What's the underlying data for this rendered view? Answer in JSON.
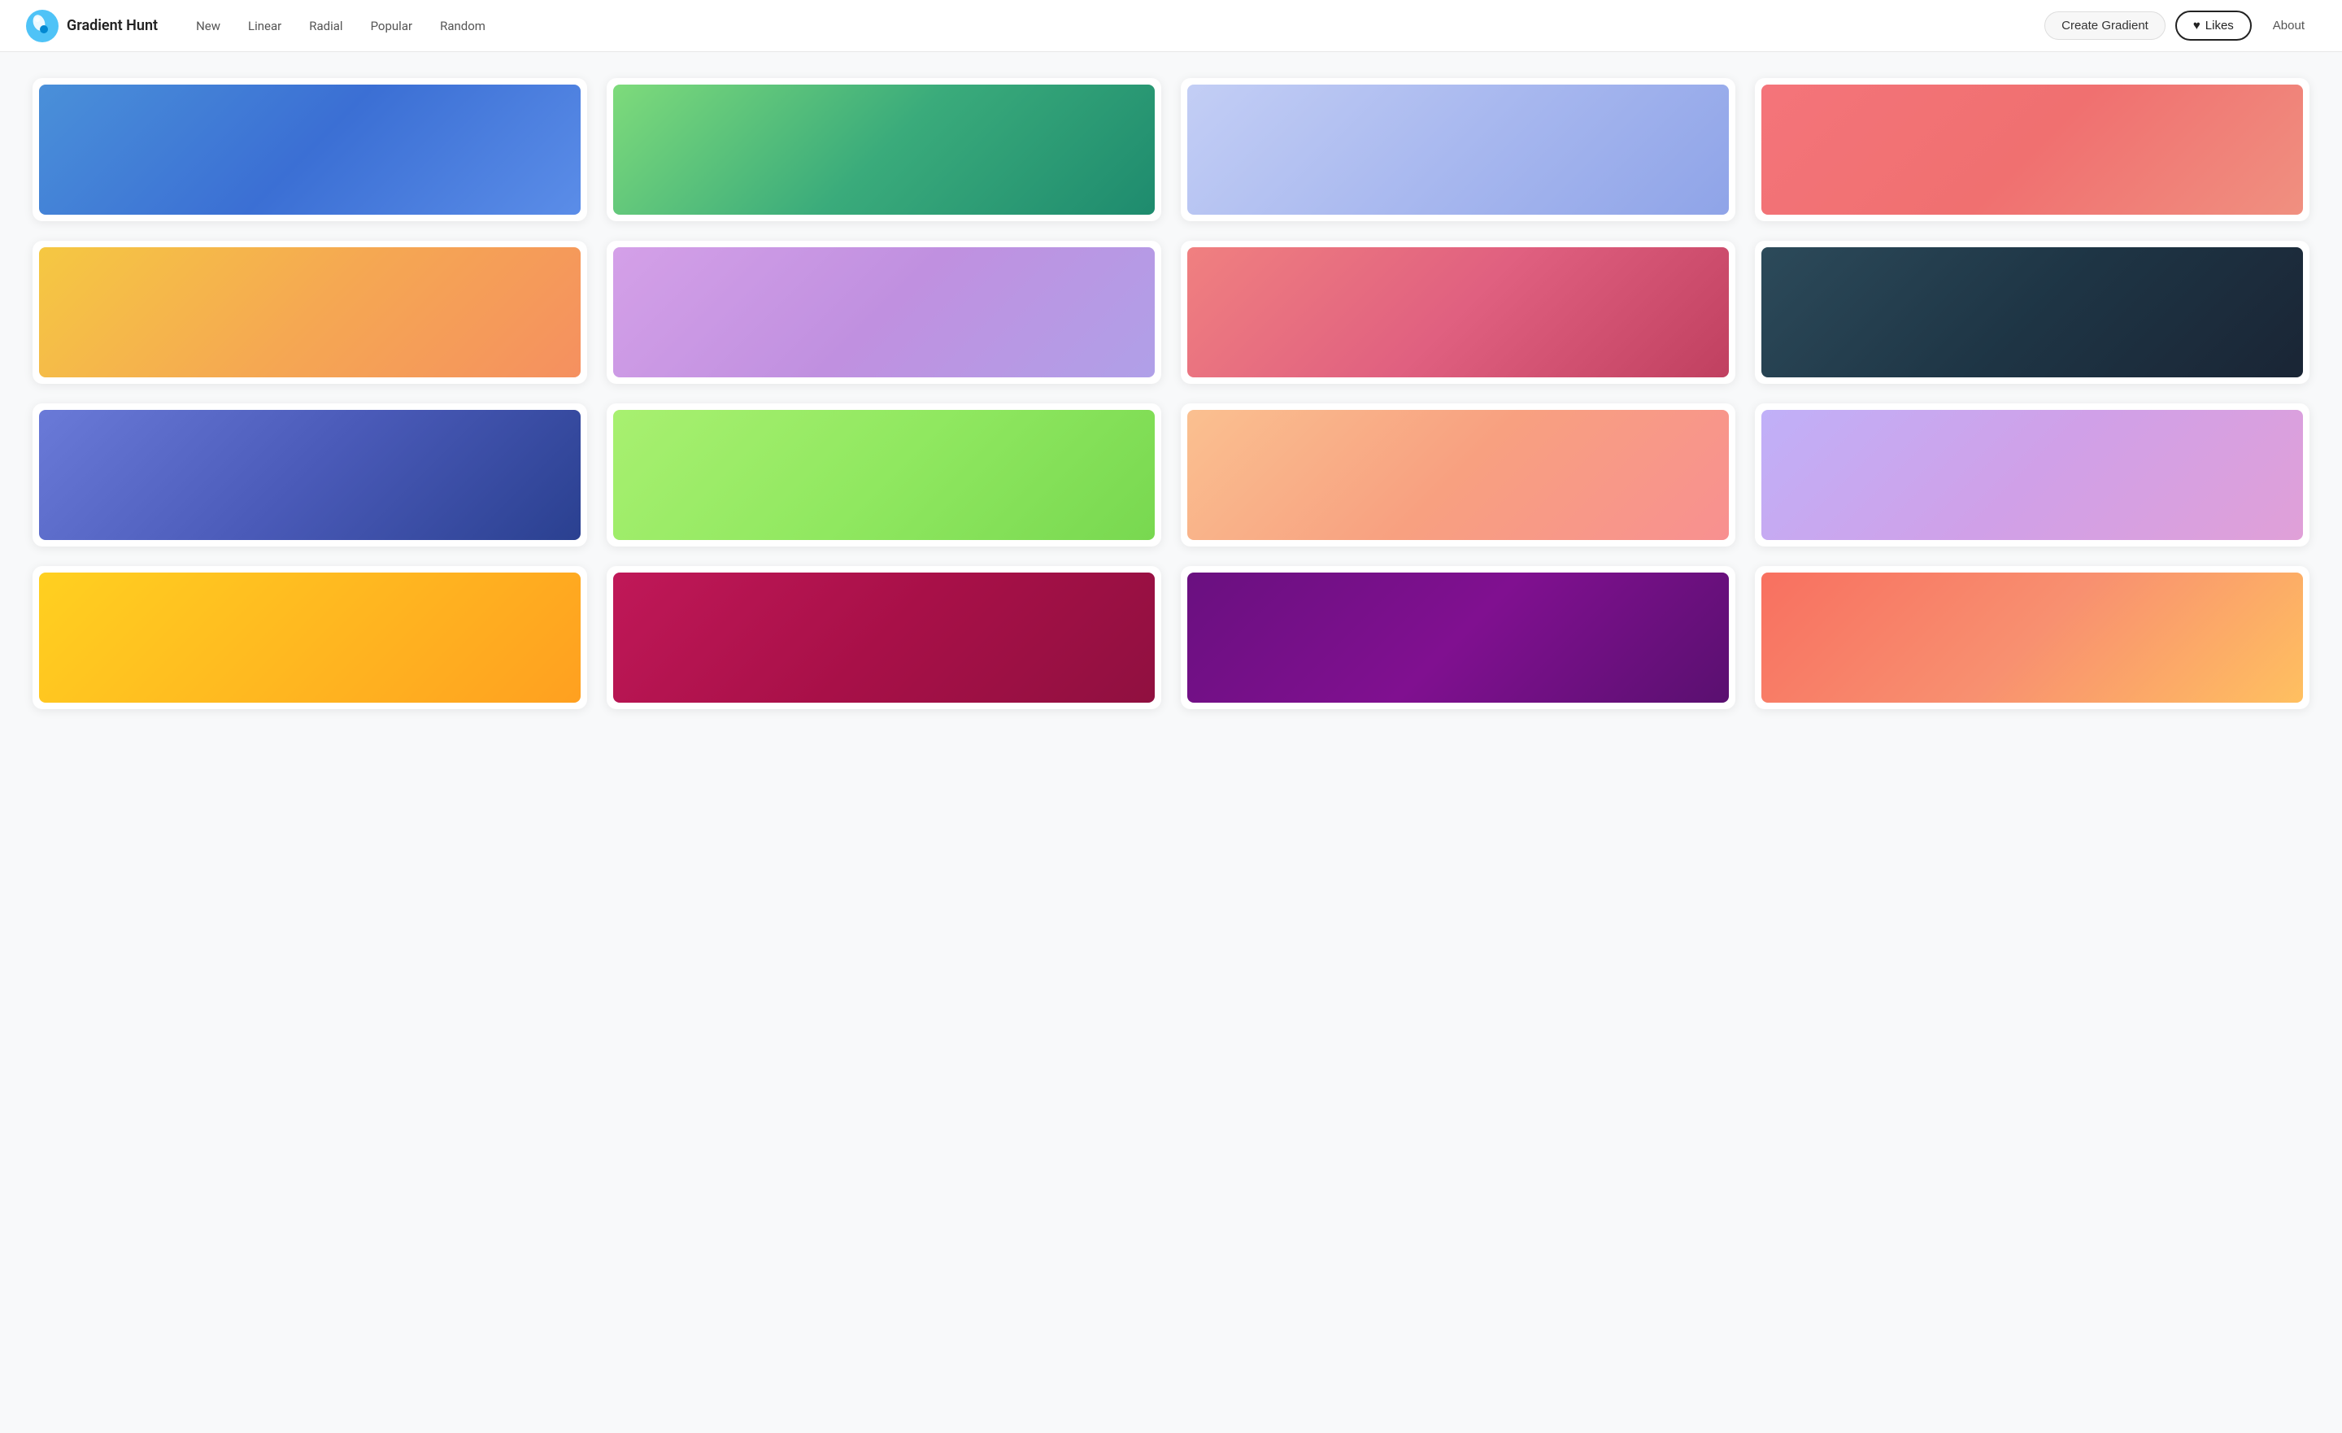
{
  "header": {
    "logo_text": "Gradient Hunt",
    "nav_items": [
      {
        "label": "New",
        "id": "new"
      },
      {
        "label": "Linear",
        "id": "linear"
      },
      {
        "label": "Radial",
        "id": "radial"
      },
      {
        "label": "Popular",
        "id": "popular"
      },
      {
        "label": "Random",
        "id": "random"
      }
    ],
    "create_button": "Create Gradient",
    "likes_button": "Likes",
    "about_button": "About",
    "heart_icon": "♥"
  },
  "gradients": [
    {
      "id": 1,
      "css": "linear-gradient(135deg, #4a90d9 0%, #3b6fd4 50%, #5b8de8 100%)"
    },
    {
      "id": 2,
      "css": "linear-gradient(135deg, #7edb7b 0%, #3aab7b 50%, #1e8b6e 100%)"
    },
    {
      "id": 3,
      "css": "linear-gradient(135deg, #c3cef5 0%, #a8b8ef 50%, #8fa4e8 100%)"
    },
    {
      "id": 4,
      "css": "linear-gradient(135deg, #f4747a 0%, #f07070 50%, #f09080 100%)"
    },
    {
      "id": 5,
      "css": "linear-gradient(135deg, #f5c842 0%, #f5a852 50%, #f59060 100%)"
    },
    {
      "id": 6,
      "css": "linear-gradient(135deg, #d4a0e8 0%, #c090e0 50%, #b0a0e8 100%)"
    },
    {
      "id": 7,
      "css": "linear-gradient(135deg, #f08080 0%, #e06080 50%, #c04060 100%)"
    },
    {
      "id": 8,
      "css": "linear-gradient(135deg, #2c4a5a 0%, #1e3545 50%, #1a2535 100%)"
    },
    {
      "id": 9,
      "css": "linear-gradient(135deg, #6a7ad8 0%, #4a5ab8 50%, #2a4090 100%)"
    },
    {
      "id": 10,
      "css": "linear-gradient(135deg, #a8f070 0%, #90e860 50%, #78d850 100%)"
    },
    {
      "id": 11,
      "css": "linear-gradient(135deg, #fac090 0%, #f8a080 50%, #f89090 100%)"
    },
    {
      "id": 12,
      "css": "linear-gradient(135deg, #c0b0f8 0%, #d0a0e8 50%, #e0a0d8 100%)"
    },
    {
      "id": 13,
      "css": "linear-gradient(135deg, #ffd020 0%, #ffb820 50%, #ffa020 100%)"
    },
    {
      "id": 14,
      "css": "linear-gradient(135deg, #c01858 0%, #a81048 50%, #901040 100%)"
    },
    {
      "id": 15,
      "css": "linear-gradient(135deg, #6a1080 0%, #801090 50%, #5a1070 100%)"
    },
    {
      "id": 16,
      "css": "linear-gradient(135deg, #f87060 0%, #f89070 50%, #ffc060 100%)"
    }
  ]
}
